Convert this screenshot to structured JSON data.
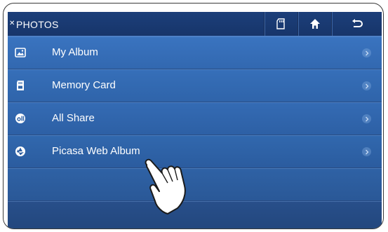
{
  "header": {
    "title": "PHOTOS"
  },
  "toolbar": {
    "buttons": [
      {
        "icon": "memory-card-icon"
      },
      {
        "icon": "home-icon"
      },
      {
        "icon": "back-icon"
      }
    ]
  },
  "menu": {
    "items": [
      {
        "label": "My Album",
        "icon": "album-icon"
      },
      {
        "label": "Memory Card",
        "icon": "memory-card-icon"
      },
      {
        "label": "All Share",
        "icon": "allshare-icon"
      },
      {
        "label": "Picasa Web Album",
        "icon": "picasa-icon"
      }
    ]
  },
  "colors": {
    "header": "#1c3f7a",
    "row": "#3268b0",
    "text": "#ffffff"
  }
}
